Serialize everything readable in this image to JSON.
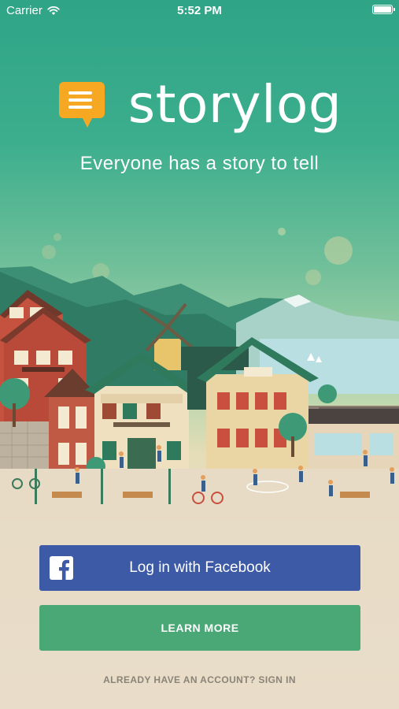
{
  "status_bar": {
    "carrier": "Carrier",
    "time": "5:52 PM",
    "wifi_icon": "wifi-icon",
    "battery_icon": "battery-icon"
  },
  "brand": {
    "name": "storylog",
    "tagline": "Everyone has a story to tell",
    "logo_icon": "speech-bubble-icon",
    "logo_color": "#f7a823"
  },
  "illustration": {
    "description_icon": "town-scene-illustration"
  },
  "actions": {
    "facebook_label": "Log in with Facebook",
    "facebook_color": "#3c5aa6",
    "learn_more_label": "LEARN MORE",
    "learn_more_color": "#4aa876",
    "signin_label": "ALREADY HAVE AN ACCOUNT? SIGN IN"
  }
}
